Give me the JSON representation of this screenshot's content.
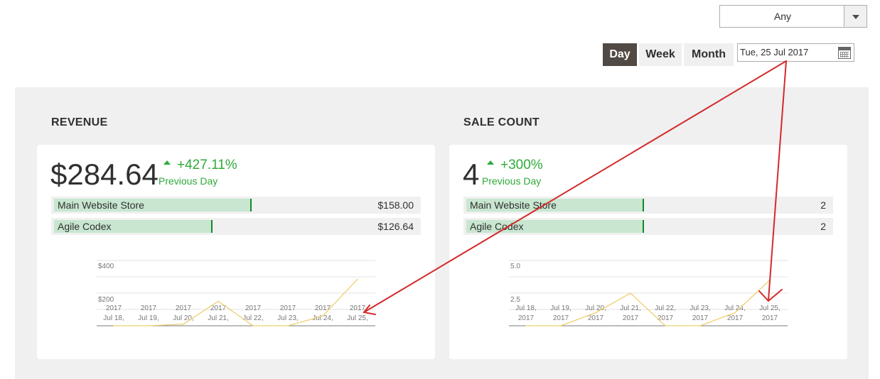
{
  "store_filter": {
    "selected": "Any"
  },
  "period": {
    "buttons": [
      {
        "label": "Day",
        "active": true
      },
      {
        "label": "Week",
        "active": false
      },
      {
        "label": "Month",
        "active": false
      }
    ],
    "date": "Tue, 25 Jul 2017",
    "calendar_icon": "calendar-icon"
  },
  "colors": {
    "accent_dark": "#514943",
    "positive": "#2eaa3a",
    "bar_fill": "#c8e6d0",
    "chart_line": "#eecf6e",
    "annotation": "#d42a2a"
  },
  "revenue": {
    "title": "REVENUE",
    "value": "$284.64",
    "change": "+427.11%",
    "change_label": "Previous Day",
    "stores": [
      {
        "name": "Main Website Store",
        "value": "$158.00",
        "share": 0.555
      },
      {
        "name": "Agile Codex",
        "value": "$126.64",
        "share": 0.445
      }
    ]
  },
  "sale_count": {
    "title": "SALE COUNT",
    "value": "4",
    "change": "+300%",
    "change_label": "Previous Day",
    "stores": [
      {
        "name": "Main Website Store",
        "value": "2",
        "share": 0.5
      },
      {
        "name": "Agile Codex",
        "value": "2",
        "share": 0.5
      }
    ]
  },
  "chart_data": [
    {
      "type": "line",
      "categories": [
        "Jul 18, 2017",
        "Jul 19, 2017",
        "Jul 20, 2017",
        "Jul 21, 2017",
        "Jul 22, 2017",
        "Jul 23, 2017",
        "Jul 24, 2017",
        "Jul 25, 2017"
      ],
      "tick_top": [
        "2017",
        "2017",
        "2017",
        "2017",
        "2017",
        "2017",
        "2017",
        "2017"
      ],
      "tick_bottom": [
        "Jul 18,",
        "Jul 19,",
        "Jul 20,",
        "Jul 21,",
        "Jul 22,",
        "Jul 23,",
        "Jul 24,",
        "Jul 25,"
      ],
      "values": [
        0,
        0,
        10,
        150,
        0,
        0,
        60,
        285
      ],
      "ytick_labels": [
        "$400",
        "$200"
      ],
      "ylim": [
        0,
        400
      ]
    },
    {
      "type": "line",
      "categories": [
        "Jul 18, 2017",
        "Jul 19, 2017",
        "Jul 20, 2017",
        "Jul 21, 2017",
        "Jul 22, 2017",
        "Jul 23, 2017",
        "Jul 24, 2017",
        "Jul 25, 2017"
      ],
      "tick_top": [
        "Jul 18,",
        "Jul 19,",
        "Jul 20,",
        "Jul 21,",
        "Jul 22,",
        "Jul 23,",
        "Jul 24,",
        "Jul 25,"
      ],
      "tick_bottom": [
        "2017",
        "2017",
        "2017",
        "2017",
        "2017",
        "2017",
        "2017",
        "2017"
      ],
      "values": [
        0,
        0,
        1,
        2.5,
        0,
        0,
        1,
        3.5
      ],
      "ytick_labels": [
        "5.0",
        "2.5"
      ],
      "ylim": [
        0,
        5
      ]
    }
  ]
}
